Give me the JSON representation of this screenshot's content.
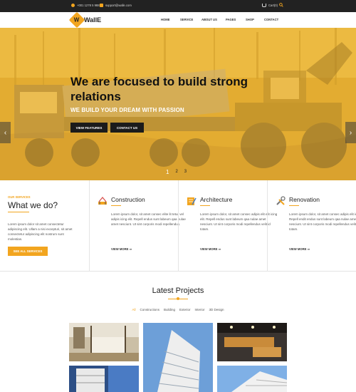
{
  "topbar": {
    "phone": "+001 1278 5 9881",
    "email": "support@walle.com",
    "cart": "Cart(0)"
  },
  "brand": {
    "name": "WallE",
    "mark": "W"
  },
  "menu": [
    "HOME",
    "SERVICE",
    "ABOUT US",
    "PAGES",
    "SHOP",
    "CONTACT"
  ],
  "hero": {
    "title": "We are focused to build strong relations",
    "subtitle": "WE BUILD YOUR DREAM WITH PASSION",
    "btn_features": "VIEW FEATURES",
    "btn_contact": "CONTACT US",
    "prev_arrow": "‹",
    "next_arrow": "›",
    "slides": [
      "1",
      "2",
      "3"
    ],
    "overlay_color": "#f2b632"
  },
  "services_intro": {
    "kicker": "OUR SERVICES",
    "title": "What we do?",
    "text": "Lorem ipsum dolor sit amet consectetur adipiscing elit. Ullam a nisi excepturi, sit amet consectetur adipiscing elit nostrum sunt molestias.",
    "button": "SEE ALL SERVICES"
  },
  "services": [
    {
      "icon": "construction-icon",
      "title": "Construction",
      "text": "Lorem ipsum dolor, sit amet consec elite lit tetur vel adipis icing elit. Repell endus sunt labeum qaa nulae amet nesciunt. Ut sint corporis modi repellendus.",
      "more": "VIEW MORE ⇒"
    },
    {
      "icon": "architecture-icon",
      "title": "Architecture",
      "text": "Lorem ipsum dolor, sit amet consec adipis elit elit icing elit. Repell endus sunt labeum qaa nulae amet nesciunt. Ut sint corporis modi repellendus velit id totam.",
      "more": "VIEW MORE ⇒"
    },
    {
      "icon": "renovation-icon",
      "title": "Renovation",
      "text": "Lorem ipsum dolor, sit amet consec adipis elit icing elit. Repell endit endus sunt labeum qaa nulae amet nesciunt. Ut sint corporis modi repellendus velit id totam.",
      "more": "VIEW MORE ⇒"
    }
  ],
  "projects": {
    "title": "Latest Projects",
    "filters": [
      "All",
      "Constructions",
      "Building",
      "Exterior",
      "Interior",
      "3D Design"
    ],
    "active_filter": "All"
  },
  "colors": {
    "accent": "#f2a51f",
    "dark": "#1b1b1b"
  }
}
